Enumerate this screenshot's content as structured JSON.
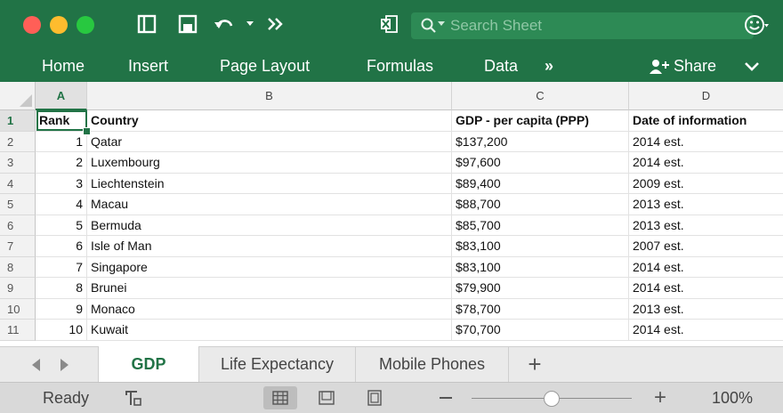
{
  "toolbar": {
    "search_placeholder": "Search Sheet",
    "icons": [
      "sidebar-icon",
      "save-icon",
      "undo-icon",
      "more-icon",
      "excel-icon",
      "search-icon",
      "smiley-icon"
    ]
  },
  "ribbon": {
    "tabs": [
      "Home",
      "Insert",
      "Page Layout",
      "Formulas",
      "Data"
    ],
    "more": "»",
    "share": "Share"
  },
  "grid": {
    "columns": [
      "A",
      "B",
      "C",
      "D"
    ],
    "row_numbers": [
      "1",
      "2",
      "3",
      "4",
      "5",
      "6",
      "7",
      "8",
      "9",
      "10",
      "11"
    ],
    "header": [
      "Rank",
      "Country",
      "GDP - per capita (PPP)",
      "Date of information"
    ],
    "rows": [
      [
        "1",
        "Qatar",
        "$137,200",
        "2014 est."
      ],
      [
        "2",
        "Luxembourg",
        "$97,600",
        "2014 est."
      ],
      [
        "3",
        "Liechtenstein",
        "$89,400",
        "2009 est."
      ],
      [
        "4",
        "Macau",
        "$88,700",
        "2013 est."
      ],
      [
        "5",
        "Bermuda",
        "$85,700",
        "2013 est."
      ],
      [
        "6",
        "Isle of Man",
        "$83,100",
        "2007 est."
      ],
      [
        "7",
        "Singapore",
        "$83,100",
        "2014 est."
      ],
      [
        "8",
        "Brunei",
        "$79,900",
        "2014 est."
      ],
      [
        "9",
        "Monaco",
        "$78,700",
        "2013 est."
      ],
      [
        "10",
        "Kuwait",
        "$70,700",
        "2014 est."
      ]
    ],
    "selected_cell": "A1"
  },
  "sheets": {
    "tabs": [
      "GDP",
      "Life Expectancy",
      "Mobile Phones"
    ],
    "active": "GDP",
    "add": "+"
  },
  "status": {
    "text": "Ready",
    "zoom": "100%",
    "zoom_fraction": 0.5
  },
  "colors": {
    "accent": "#217346",
    "header_bg": "#f2f2f2"
  }
}
